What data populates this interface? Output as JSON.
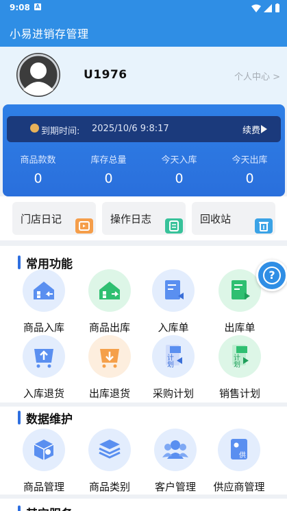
{
  "status_bar": {
    "time": "9:08",
    "notif_icon": "A"
  },
  "app": {
    "title": "小易进销存管理"
  },
  "profile": {
    "username": "U1976",
    "personal_center": "个人中心 >"
  },
  "card": {
    "expire_label": "到期时间:",
    "expire_value": "2025/10/6 9:8:17",
    "renew_label": "续费",
    "stats": [
      {
        "label": "商品款数",
        "value": "0"
      },
      {
        "label": "库存总量",
        "value": "0"
      },
      {
        "label": "今天入库",
        "value": "0"
      },
      {
        "label": "今天出库",
        "value": "0"
      }
    ]
  },
  "quick": [
    {
      "label": "门店日记",
      "color": "#f59e4a"
    },
    {
      "label": "操作日志",
      "color": "#38c29a"
    },
    {
      "label": "回收站",
      "color": "#3ba3e6"
    }
  ],
  "sections": {
    "common": {
      "title": "常用功能",
      "items": [
        {
          "label": "商品入库",
          "icon": "stock-in-icon"
        },
        {
          "label": "商品出库",
          "icon": "stock-out-icon"
        },
        {
          "label": "入库单",
          "icon": "inbound-order-icon"
        },
        {
          "label": "出库单",
          "icon": "outbound-order-icon"
        },
        {
          "label": "入库退货",
          "icon": "inbound-return-icon"
        },
        {
          "label": "出库退货",
          "icon": "outbound-return-icon"
        },
        {
          "label": "采购计划",
          "icon": "purchase-plan-icon",
          "glyph": "计划"
        },
        {
          "label": "销售计划",
          "icon": "sales-plan-icon",
          "glyph": "计划"
        }
      ]
    },
    "data": {
      "title": "数据维护",
      "items": [
        {
          "label": "商品管理",
          "icon": "product-manage-icon"
        },
        {
          "label": "商品类别",
          "icon": "product-category-icon"
        },
        {
          "label": "客户管理",
          "icon": "customer-manage-icon"
        },
        {
          "label": "供应商管理",
          "icon": "supplier-manage-icon",
          "glyph": "供"
        }
      ]
    },
    "other": {
      "title": "其它服务"
    }
  },
  "colors": {
    "primary": "#2f8ee5",
    "card": "#2a6fdc",
    "blue_icon": "#5a8ff0",
    "green_icon": "#2fbf71",
    "orange_icon": "#f5a04a"
  }
}
